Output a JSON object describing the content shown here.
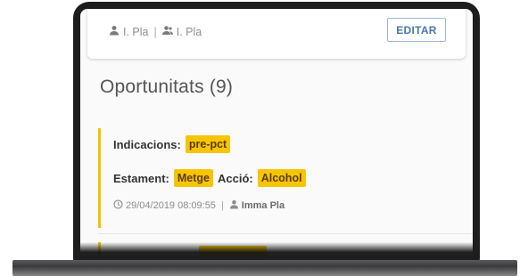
{
  "header": {
    "owner_name": "I. Pla",
    "assignee_name": "I. Pla",
    "separator": "|",
    "edit_label": "EDITAR"
  },
  "section": {
    "title": "Oportunitats (9)"
  },
  "opportunity": {
    "indications_label": "Indicacions:",
    "indications_value": "pre-pct",
    "state_label": "Estament:",
    "state_value": "Metge",
    "action_label": "Acció:",
    "action_value": "Alcohol",
    "timestamp": "29/04/2019 08:09:55",
    "separator": "|",
    "author": "Imma Pla"
  },
  "colors": {
    "accent_yellow": "#f7c500",
    "button_blue": "#4a76a8"
  },
  "icons": {
    "owner": "user-icon",
    "assignee": "users-icon",
    "time": "clock-icon",
    "author": "user-icon"
  }
}
